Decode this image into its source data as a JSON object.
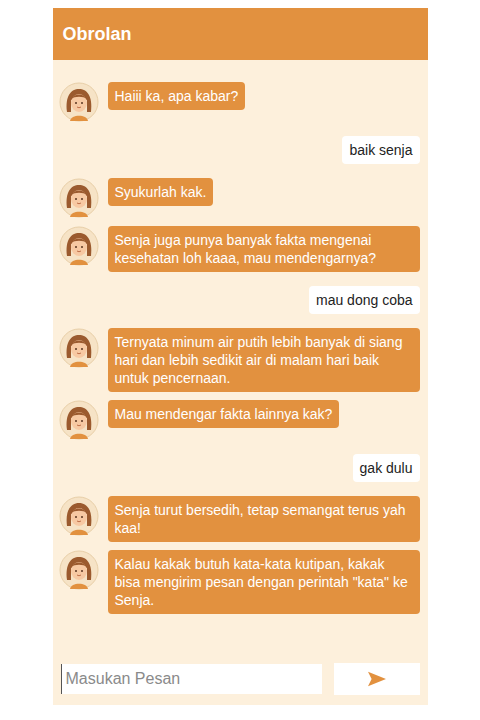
{
  "header": {
    "title": "Obrolan"
  },
  "messages": [
    {
      "kind": "bot",
      "text": "Haiii ka, apa kabar?"
    },
    {
      "kind": "user",
      "text": "baik senja"
    },
    {
      "kind": "bot",
      "text": "Syukurlah kak."
    },
    {
      "kind": "bot",
      "text": "Senja juga punya banyak fakta mengenai kesehatan loh kaaa, mau mendengarnya?"
    },
    {
      "kind": "user",
      "text": "mau dong coba"
    },
    {
      "kind": "bot",
      "text": "Ternyata minum air putih lebih banyak di siang hari dan lebih sedikit air di malam hari baik untuk pencernaan."
    },
    {
      "kind": "bot",
      "text": "Mau mendengar fakta lainnya kak?"
    },
    {
      "kind": "user",
      "text": "gak dulu"
    },
    {
      "kind": "bot",
      "text": "Senja turut bersedih, tetap semangat terus yah kaa!"
    },
    {
      "kind": "bot",
      "text": "Kalau kakak butuh kata-kata kutipan, kakak bisa mengirim pesan dengan perintah \"kata\" ke Senja."
    }
  ],
  "input": {
    "placeholder": "Masukan Pesan"
  }
}
